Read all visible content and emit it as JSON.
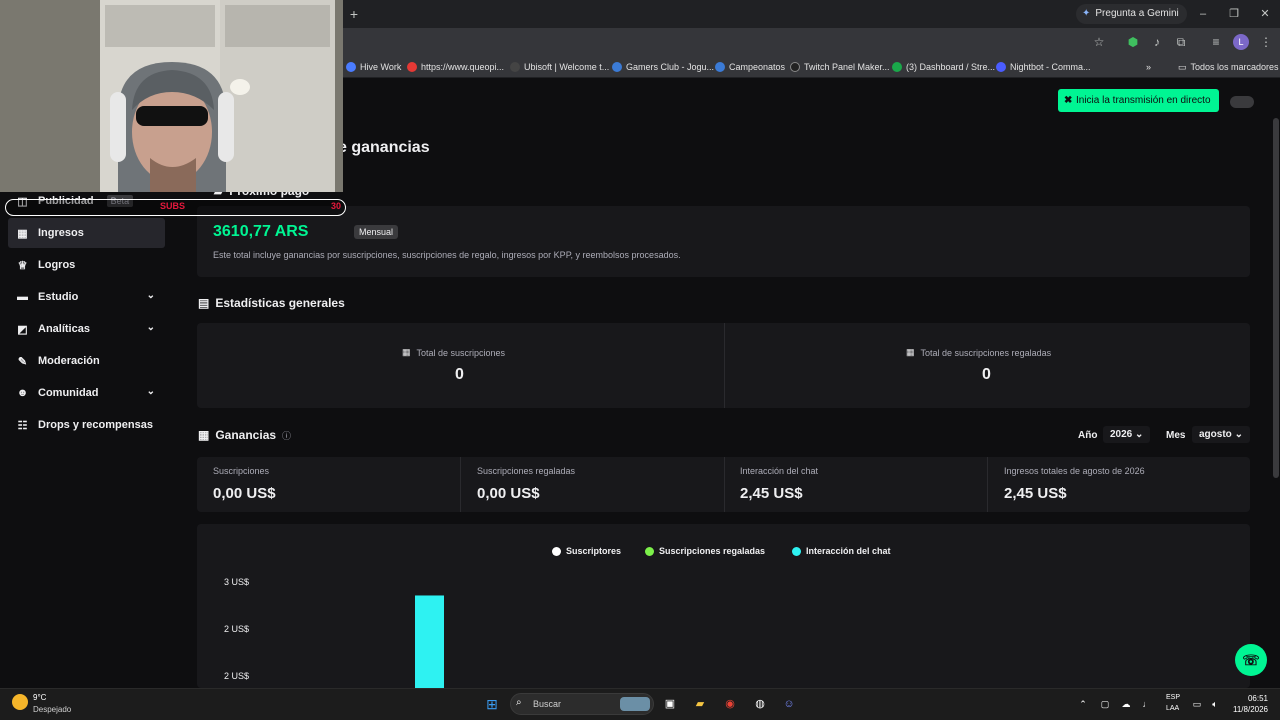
{
  "browser": {
    "gemini_label": "Pregunta a Gemini",
    "profile_initial": "L",
    "bookmarks": [
      {
        "label": "Hive Work",
        "color": "#4a7cff"
      },
      {
        "label": "https://www.queopi...",
        "color": "#e53935"
      },
      {
        "label": "Ubisoft | Welcome t...",
        "color": "#444444"
      },
      {
        "label": "Gamers Club - Jogu...",
        "color": "#3b7bd6"
      },
      {
        "label": "Campeonatos",
        "color": "#3b7bd6"
      },
      {
        "label": "Twitch Panel Maker...",
        "color": "#222222"
      },
      {
        "label": "(3) Dashboard / Stre...",
        "color": "#1aa84a"
      },
      {
        "label": "Nightbot - Comma...",
        "color": "#4a5cff"
      }
    ],
    "all_bookmarks": "Todos los marcadores"
  },
  "header": {
    "live_button": "Inicia la transmisión en directo",
    "page_title": "e ganancias",
    "next_payment_title": "Próximo pago"
  },
  "sidebar": {
    "items": [
      {
        "label": "Publicidad",
        "icon": "megaphone-icon",
        "badge": "Beta"
      },
      {
        "label": "Ingresos",
        "icon": "chart-icon",
        "active": true
      },
      {
        "label": "Logros",
        "icon": "trophy-icon"
      },
      {
        "label": "Estudio",
        "icon": "video-icon",
        "expandable": true
      },
      {
        "label": "Analíticas",
        "icon": "analytics-icon",
        "expandable": true
      },
      {
        "label": "Moderación",
        "icon": "wrench-icon"
      },
      {
        "label": "Comunidad",
        "icon": "people-icon",
        "expandable": true
      },
      {
        "label": "Drops y recompensas",
        "icon": "drops-icon"
      }
    ]
  },
  "payment": {
    "amount": "3610,77 ARS",
    "currency": "ARS",
    "period_badge": "Mensual",
    "note": "Este total incluye ganancias por suscripciones, suscripciones de regalo, ingresos por KPP, y reembolsos procesados."
  },
  "stats": {
    "title": "Estadísticas generales",
    "items": [
      {
        "label": "Total de suscripciones",
        "value": "0"
      },
      {
        "label": "Total de suscripciones regaladas",
        "value": "0"
      }
    ]
  },
  "earnings": {
    "title": "Ganancias",
    "year_label": "Año",
    "year_value": "2026",
    "month_label": "Mes",
    "month_value": "agosto",
    "items": [
      {
        "label": "Suscripciones",
        "value": "0,00 US$"
      },
      {
        "label": "Suscripciones regaladas",
        "value": "0,00 US$"
      },
      {
        "label": "Interacción del chat",
        "value": "2,45 US$"
      },
      {
        "label": "Ingresos totales de agosto de 2026",
        "value": "2,45 US$"
      }
    ]
  },
  "chart_data": {
    "type": "bar",
    "series": [
      {
        "name": "Suscriptores",
        "color": "#ffffff"
      },
      {
        "name": "Suscripciones regaladas",
        "color": "#7cf04a"
      },
      {
        "name": "Interacción del chat",
        "color": "#2ef2f2"
      }
    ],
    "y_tick_labels": [
      "3 US$",
      "2 US$",
      "2 US$"
    ],
    "bars": [
      {
        "series": "Interacción del chat",
        "value": 2.45
      }
    ]
  },
  "stream_overlay": {
    "subs_label": "SUBS",
    "subs_count": "30"
  },
  "taskbar": {
    "temperature": "9°C",
    "weather": "Despejado",
    "search_placeholder": "Buscar",
    "lang_line1": "ESP",
    "lang_line2": "LAA",
    "time": "06:51",
    "date": "11/8/2026"
  }
}
